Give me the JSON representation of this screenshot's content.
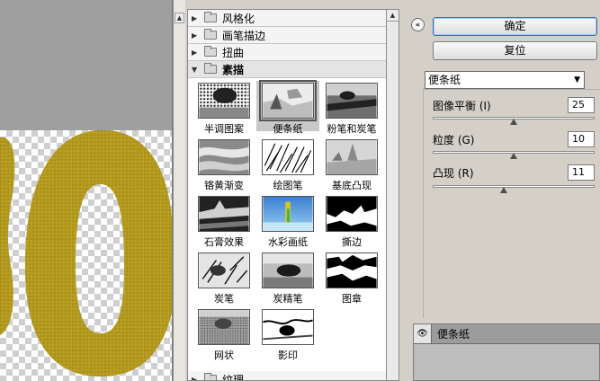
{
  "gallery": {
    "categories_top": [
      {
        "label": "风格化"
      },
      {
        "label": "画笔描边"
      },
      {
        "label": "扭曲"
      }
    ],
    "open_category": {
      "label": "素描"
    },
    "thumbnails": [
      {
        "label": "半调图案"
      },
      {
        "label": "便条纸",
        "selected": true
      },
      {
        "label": "粉笔和炭笔"
      },
      {
        "label": "铬黄渐变"
      },
      {
        "label": "绘图笔"
      },
      {
        "label": "基底凸现"
      },
      {
        "label": "石膏效果"
      },
      {
        "label": "水彩画纸"
      },
      {
        "label": "撕边"
      },
      {
        "label": "炭笔"
      },
      {
        "label": "炭精笔"
      },
      {
        "label": "图章"
      },
      {
        "label": "网状"
      },
      {
        "label": "影印"
      }
    ],
    "category_bottom": {
      "label": "纹理"
    }
  },
  "buttons": {
    "ok": "确定",
    "reset": "复位"
  },
  "filter_select": {
    "value": "便条纸"
  },
  "params": [
    {
      "label": "图像平衡 (I)",
      "value": "25",
      "fraction": 0.5
    },
    {
      "label": "粒度 (G)",
      "value": "10",
      "fraction": 0.5
    },
    {
      "label": "凸现 (R)",
      "value": "11",
      "fraction": 0.44
    }
  ],
  "layers": {
    "items": [
      {
        "label": "便条纸"
      }
    ]
  },
  "colors": {
    "artwork_gold": "#b39a1e",
    "selection_gray": "#c8c8c8"
  }
}
